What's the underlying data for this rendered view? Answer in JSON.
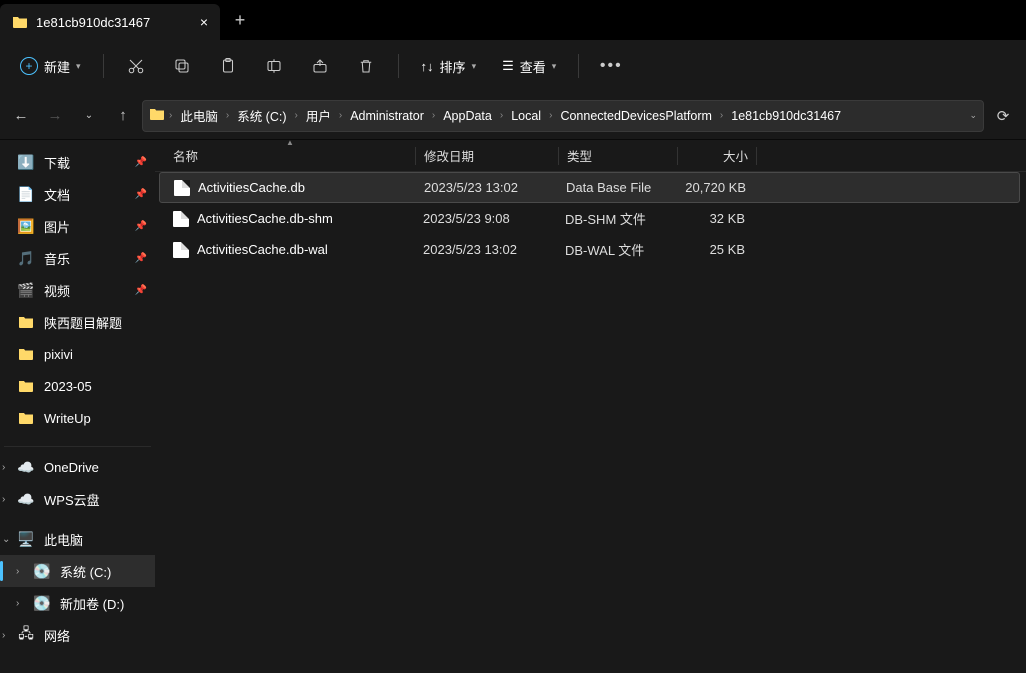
{
  "tab": {
    "title": "1e81cb910dc31467"
  },
  "toolbar": {
    "new_label": "新建",
    "sort_label": "排序",
    "view_label": "查看"
  },
  "breadcrumbs": [
    "此电脑",
    "系统 (C:)",
    "用户",
    "Administrator",
    "AppData",
    "Local",
    "ConnectedDevicesPlatform",
    "1e81cb910dc31467"
  ],
  "sidebar": {
    "quick": [
      {
        "label": "下载",
        "icon": "download",
        "pinned": true
      },
      {
        "label": "文档",
        "icon": "doc",
        "pinned": true
      },
      {
        "label": "图片",
        "icon": "pic",
        "pinned": true
      },
      {
        "label": "音乐",
        "icon": "music",
        "pinned": true
      },
      {
        "label": "视频",
        "icon": "video",
        "pinned": true
      },
      {
        "label": "陕西题目解题",
        "icon": "folder",
        "pinned": false
      },
      {
        "label": "pixivi",
        "icon": "folder",
        "pinned": false
      },
      {
        "label": "2023-05",
        "icon": "folder",
        "pinned": false
      },
      {
        "label": "WriteUp",
        "icon": "folder",
        "pinned": false
      }
    ],
    "clouds": [
      {
        "label": "OneDrive",
        "icon": "cloud-blue"
      },
      {
        "label": "WPS云盘",
        "icon": "cloud-white"
      }
    ],
    "thispc": {
      "label": "此电脑",
      "icon": "pc"
    },
    "drives": [
      {
        "label": "系统 (C:)",
        "icon": "drive",
        "selected": true
      },
      {
        "label": "新加卷 (D:)",
        "icon": "drive",
        "selected": false
      }
    ],
    "network": {
      "label": "网络",
      "icon": "net"
    }
  },
  "columns": {
    "name": "名称",
    "date": "修改日期",
    "type": "类型",
    "size": "大小"
  },
  "files": [
    {
      "name": "ActivitiesCache.db",
      "date": "2023/5/23 13:02",
      "type": "Data Base File",
      "size": "20,720 KB",
      "selected": true
    },
    {
      "name": "ActivitiesCache.db-shm",
      "date": "2023/5/23 9:08",
      "type": "DB-SHM 文件",
      "size": "32 KB",
      "selected": false
    },
    {
      "name": "ActivitiesCache.db-wal",
      "date": "2023/5/23 13:02",
      "type": "DB-WAL 文件",
      "size": "25 KB",
      "selected": false
    }
  ]
}
